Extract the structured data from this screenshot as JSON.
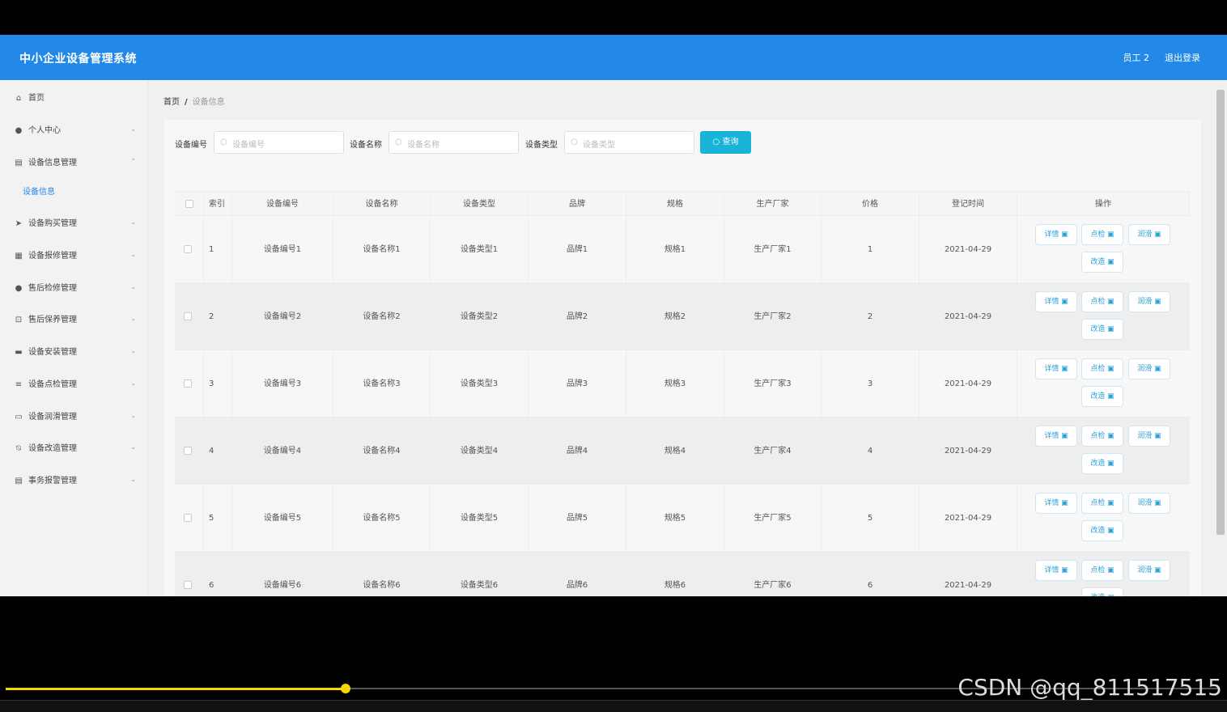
{
  "header": {
    "title": "中小企业设备管理系统",
    "user": "员工 2",
    "logout": "退出登录"
  },
  "sidebar": {
    "items": [
      {
        "label": "首页",
        "icon": "home-icon",
        "glyph": "⌂",
        "arrow": ""
      },
      {
        "label": "个人中心",
        "icon": "user-icon",
        "glyph": "●",
        "arrow": "⌄"
      },
      {
        "label": "设备信息管理",
        "icon": "clipboard-icon",
        "glyph": "▤",
        "arrow": "⌃"
      },
      {
        "label": "设备信息",
        "icon": "",
        "glyph": "",
        "arrow": ""
      },
      {
        "label": "设备购买管理",
        "icon": "send-icon",
        "glyph": "➤",
        "arrow": "⌄"
      },
      {
        "label": "设备报修管理",
        "icon": "grid-icon",
        "glyph": "▦",
        "arrow": "⌄"
      },
      {
        "label": "售后检修管理",
        "icon": "user-icon",
        "glyph": "●",
        "arrow": "⌄"
      },
      {
        "label": "售后保养管理",
        "icon": "crop-icon",
        "glyph": "⊡",
        "arrow": "⌄"
      },
      {
        "label": "设备安装管理",
        "icon": "briefcase-icon",
        "glyph": "▬",
        "arrow": "⌄"
      },
      {
        "label": "设备点检管理",
        "icon": "list-icon",
        "glyph": "≡",
        "arrow": "⌄"
      },
      {
        "label": "设备润滑管理",
        "icon": "message-icon",
        "glyph": "▭",
        "arrow": "⌄"
      },
      {
        "label": "设备改造管理",
        "icon": "mute-icon",
        "glyph": "⍉",
        "arrow": "⌄"
      },
      {
        "label": "事务报警管理",
        "icon": "clipboard-icon",
        "glyph": "▤",
        "arrow": "⌄"
      }
    ]
  },
  "breadcrumb": {
    "home": "首页",
    "sep": "/",
    "current": "设备信息"
  },
  "search": {
    "fields": [
      {
        "label": "设备编号",
        "placeholder": "设备编号"
      },
      {
        "label": "设备名称",
        "placeholder": "设备名称"
      },
      {
        "label": "设备类型",
        "placeholder": "设备类型"
      }
    ],
    "button": "查询",
    "mag_icon": "○"
  },
  "table": {
    "headers": [
      "索引",
      "设备编号",
      "设备名称",
      "设备类型",
      "品牌",
      "规格",
      "生产厂家",
      "价格",
      "登记时间",
      "操作"
    ],
    "rows": [
      [
        "1",
        "设备编号1",
        "设备名称1",
        "设备类型1",
        "品牌1",
        "规格1",
        "生产厂家1",
        "1",
        "2021-04-29"
      ],
      [
        "2",
        "设备编号2",
        "设备名称2",
        "设备类型2",
        "品牌2",
        "规格2",
        "生产厂家2",
        "2",
        "2021-04-29"
      ],
      [
        "3",
        "设备编号3",
        "设备名称3",
        "设备类型3",
        "品牌3",
        "规格3",
        "生产厂家3",
        "3",
        "2021-04-29"
      ],
      [
        "4",
        "设备编号4",
        "设备名称4",
        "设备类型4",
        "品牌4",
        "规格4",
        "生产厂家4",
        "4",
        "2021-04-29"
      ],
      [
        "5",
        "设备编号5",
        "设备名称5",
        "设备类型5",
        "品牌5",
        "规格5",
        "生产厂家5",
        "5",
        "2021-04-29"
      ],
      [
        "6",
        "设备编号6",
        "设备名称6",
        "设备类型6",
        "品牌6",
        "规格6",
        "生产厂家6",
        "6",
        "2021-04-29"
      ]
    ],
    "actions": [
      "详情 ▣",
      "点检 ▣",
      "润滑 ▣",
      "改造 ▣"
    ]
  },
  "video": {
    "watermark": "CSDN @qq_811517515",
    "progress": 0.28
  },
  "colors": {
    "header": "#2389e8",
    "accent": "#17b3d9",
    "progress": "#f5d800"
  }
}
